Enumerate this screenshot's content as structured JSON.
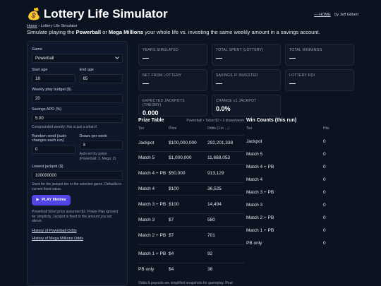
{
  "header": {
    "logo": "💰",
    "title": "Lottery Life Simulator",
    "home_link": "— HOME",
    "author": "by Jeff Gilbert",
    "breadcrumb": {
      "home": "Home",
      "sep": "›",
      "current": "Lottery Life Simulator"
    },
    "subtitle": {
      "pre": "Simulate playing the ",
      "game1": "Powerball",
      "mid": " or ",
      "game2": "Mega Millions",
      "post": " your whole life vs. investing the same weekly amount in a savings account."
    }
  },
  "sidebar": {
    "game_label": "Game",
    "game_value": "Powerball",
    "start_age_label": "Start age",
    "start_age_value": "18",
    "end_age_label": "End age",
    "end_age_value": "65",
    "budget_label": "Weekly play budget ($)",
    "budget_value": "20",
    "apr_label": "Savings APR (%)",
    "apr_value": "5.00",
    "apr_hint": "Compounded weekly; this is just a what-if.",
    "seed_label": "Random seed (auto-changes each run)",
    "seed_value": "0",
    "draws_label": "Draws per week",
    "draws_value": "3",
    "draws_hint": "Auto-set by game (Powerball: 3, Mega: 2)",
    "jackpot_label": "Lowest jackpot ($)",
    "jackpot_value": "100000000",
    "jackpot_hint": "Used for the jackpot tier in the selected game. Defaults to current fixed value.",
    "play_label": "PLAY lifetime",
    "play_icon": "play-icon",
    "note": "Powerball ticket price assumed $2. Power Play ignored for simplicity. Jackpot is fixed to the amount you set above.",
    "link1": "History of Powerball Odds",
    "link2": "History of Mega Millions Odds"
  },
  "stats": [
    {
      "label": "YEARS SIMULATED",
      "value": "—"
    },
    {
      "label": "TOTAL SPENT (LOTTERY)",
      "value": "—"
    },
    {
      "label": "TOTAL WINNINGS",
      "value": "—"
    },
    {
      "label": "NET FROM LOTTERY",
      "value": "—"
    },
    {
      "label": "SAVINGS IF INVESTED",
      "value": "—"
    },
    {
      "label": "LOTTERY ROI",
      "value": "—"
    },
    {
      "label": "EXPECTED JACKPOTS (THEORY)",
      "value": "0.000"
    },
    {
      "label": "CHANCE ≥1 JACKPOT",
      "value": "0.0%"
    }
  ],
  "prize_table": {
    "title": "Prize Table",
    "meta": "Powerball • Ticket $2 • 3 draws/week",
    "headers": [
      "Tier",
      "Prize",
      "Odds (1 in …)"
    ],
    "rows": [
      [
        "Jackpot",
        "$100,000,000",
        "292,201,338"
      ],
      [
        "Match 5",
        "$1,000,000",
        "11,688,053"
      ],
      [
        "Match 4 + PB",
        "$50,000",
        "913,129"
      ],
      [
        "Match 4",
        "$100",
        "36,525"
      ],
      [
        "Match 3 + PB",
        "$100",
        "14,494"
      ],
      [
        "Match 3",
        "$7",
        "580"
      ],
      [
        "Match 2 + PB",
        "$7",
        "701"
      ],
      [
        "Match 1 + PB",
        "$4",
        "92"
      ],
      [
        "PB only",
        "$4",
        "38"
      ]
    ]
  },
  "wins_table": {
    "title": "Win Counts (this run)",
    "headers": [
      "Tier",
      "Hits"
    ],
    "rows": [
      [
        "Jackpot",
        "0"
      ],
      [
        "Match 5",
        "0"
      ],
      [
        "Match 4 + PB",
        "0"
      ],
      [
        "Match 4",
        "0"
      ],
      [
        "Match 3 + PB",
        "0"
      ],
      [
        "Match 3",
        "0"
      ],
      [
        "Match 2 + PB",
        "0"
      ],
      [
        "Match 1 + PB",
        "0"
      ],
      [
        "PB only",
        "0"
      ]
    ]
  },
  "footnote": "Odds & payouts are simplified snapshots for gameplay. Real"
}
